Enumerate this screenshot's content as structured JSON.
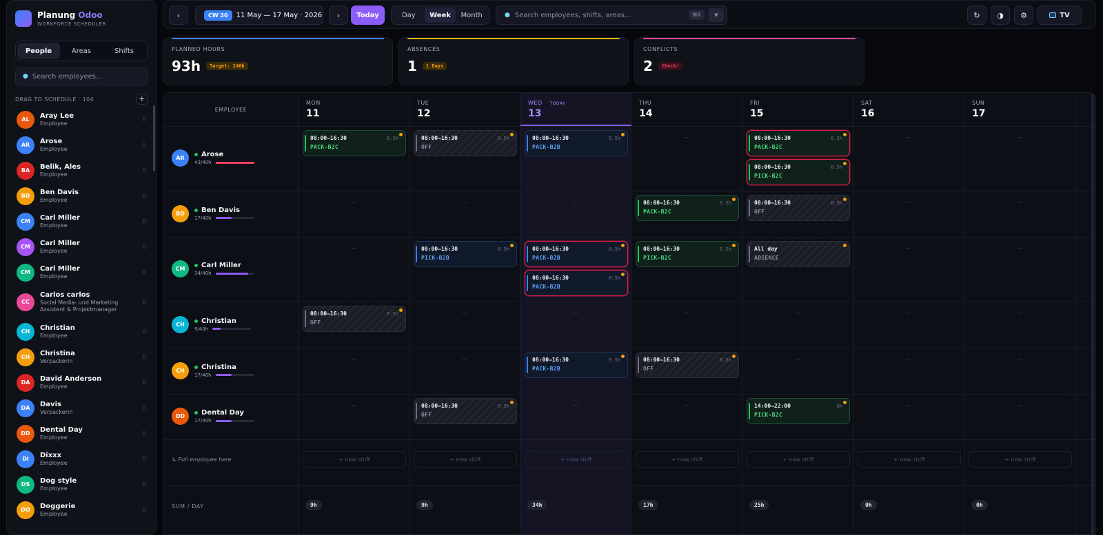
{
  "brand": {
    "title": "Planung",
    "title_accent": "Odoo",
    "subtitle": "WORKFORCE SCHEDULER"
  },
  "sidebar": {
    "tabs": [
      "People",
      "Areas",
      "Shifts"
    ],
    "search_placeholder": "Search employees...",
    "drag_label": "DRAG TO SCHEDULE · 104",
    "add_label": "+",
    "people": [
      {
        "initials": "AL",
        "name": "Aray Lee",
        "role": "Employee",
        "color": "#ea580c"
      },
      {
        "initials": "AR",
        "name": "Arose",
        "role": "Employee",
        "color": "#3b82f6"
      },
      {
        "initials": "BA",
        "name": "Belik, Ales",
        "role": "Employee",
        "color": "#dc2626"
      },
      {
        "initials": "BD",
        "name": "Ben Davis",
        "role": "Employee",
        "color": "#f59e0b"
      },
      {
        "initials": "CM",
        "name": "Carl Miller",
        "role": "Employee",
        "color": "#3b82f6"
      },
      {
        "initials": "CM",
        "name": "Carl Miller",
        "role": "Employee",
        "color": "#a855f7"
      },
      {
        "initials": "CM",
        "name": "Carl Miller",
        "role": "Employee",
        "color": "#10b981"
      },
      {
        "initials": "CC",
        "name": "Carlos carlos",
        "role": "Social Media- und Marketing Assistent & Projektmanager",
        "color": "#ec4899"
      },
      {
        "initials": "CH",
        "name": "Christian",
        "role": "Employee",
        "color": "#06b6d4"
      },
      {
        "initials": "CH",
        "name": "Christina",
        "role": "Verpackerin",
        "color": "#f59e0b"
      },
      {
        "initials": "DA",
        "name": "David Anderson",
        "role": "Employee",
        "color": "#dc2626"
      },
      {
        "initials": "DA",
        "name": "Davis",
        "role": "Verpackerin",
        "color": "#3b82f6"
      },
      {
        "initials": "DD",
        "name": "Dental Day",
        "role": "Employee",
        "color": "#ea580c"
      },
      {
        "initials": "DI",
        "name": "Dixxx",
        "role": "Employee",
        "color": "#3b82f6"
      },
      {
        "initials": "DS",
        "name": "Dog style",
        "role": "Employee",
        "color": "#10b981"
      },
      {
        "initials": "DO",
        "name": "Doggerie",
        "role": "Employee",
        "color": "#f59e0b"
      }
    ]
  },
  "topbar": {
    "prev": "‹",
    "next": "›",
    "cw": "CW 20",
    "range": "11 May — 17 May · 2026",
    "today": "Today",
    "views": [
      "Day",
      "Week",
      "Month"
    ],
    "search_placeholder": "Search employees, shifts, areas...",
    "shortcut": "⌘K",
    "refresh_icon": "↻",
    "contrast_icon": "◑",
    "settings_icon": "⚙",
    "tv_label": "TV"
  },
  "stats": [
    {
      "label": "PLANNED HOURS",
      "value": "93h",
      "badge": "Target: 240h",
      "color": "#3b82f6",
      "badge_bg": "#3a2a0c",
      "badge_fg": "#f59e0b"
    },
    {
      "label": "ABSENCES",
      "value": "1",
      "badge": "1 Days",
      "color": "#eab308",
      "badge_bg": "#3a2a0c",
      "badge_fg": "#f59e0b"
    },
    {
      "label": "CONFLICTS",
      "value": "2",
      "badge": "Check!",
      "color": "#ec4899",
      "badge_bg": "#3a0f1c",
      "badge_fg": "#f43f5e"
    }
  ],
  "grid": {
    "employee_header": "EMPLOYEE",
    "days": [
      {
        "name": "MON",
        "num": "11"
      },
      {
        "name": "TUE",
        "num": "12"
      },
      {
        "name": "WED",
        "num": "13",
        "today": "· TODAY"
      },
      {
        "name": "THU",
        "num": "14"
      },
      {
        "name": "FRI",
        "num": "15"
      },
      {
        "name": "SAT",
        "num": "16"
      },
      {
        "name": "SUN",
        "num": "17"
      }
    ],
    "employees": [
      {
        "initials": "AR",
        "name": "Arose",
        "hours": "43/40h",
        "fill": 1.0,
        "bar": "#f43f5e",
        "color": "#3b82f6"
      },
      {
        "initials": "BD",
        "name": "Ben Davis",
        "hours": "17/40h",
        "fill": 0.42,
        "bar": "#8b5cf6",
        "color": "#f59e0b"
      },
      {
        "initials": "CM",
        "name": "Carl Miller",
        "hours": "34/40h",
        "fill": 0.85,
        "bar": "#8b5cf6",
        "color": "#10b981"
      },
      {
        "initials": "CH",
        "name": "Christian",
        "hours": "9/40h",
        "fill": 0.22,
        "bar": "#8b5cf6",
        "color": "#06b6d4"
      },
      {
        "initials": "CH",
        "name": "Christina",
        "hours": "17/40h",
        "fill": 0.42,
        "bar": "#8b5cf6",
        "color": "#f59e0b"
      },
      {
        "initials": "DD",
        "name": "Dental Day",
        "hours": "17/40h",
        "fill": 0.42,
        "bar": "#8b5cf6",
        "color": "#ea580c"
      }
    ],
    "shifts": {
      "time": "08:00–16:30",
      "hours": "8.5h",
      "late_time": "14:00–22:00",
      "late_hours": "8h",
      "allday": "All day",
      "pack_b2c": "PACK-B2C",
      "pack_b2b": "PACK-B2B",
      "pick_b2c": "PICK-B2C",
      "pick_b2b": "PICK-B2B",
      "off": "OFF",
      "absence": "ABSENCE"
    },
    "empty": "—",
    "new_shift": "+ new shift",
    "pull": "↳ Pull employee here",
    "sum_label": "SUM / DAY",
    "sums": [
      "9h",
      "9h",
      "34h",
      "17h",
      "25h",
      "0h",
      "0h"
    ]
  }
}
